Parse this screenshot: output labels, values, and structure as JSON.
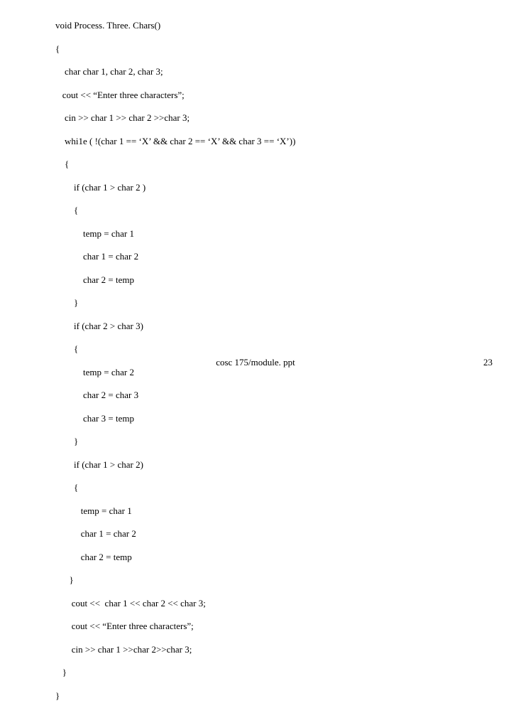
{
  "code": {
    "l01": "void Process. Three. Chars()",
    "l02": "{",
    "l03": "    char char 1, char 2, char 3;",
    "l04": "   cout << “Enter three characters”;",
    "l05": "    cin >> char 1 >> char 2 >>char 3;",
    "l06": "    whi1e ( !(char 1 == ‘X’ && char 2 == ‘X’ && char 3 == ‘X’))",
    "l07": "    {",
    "l08": "        if (char 1 > char 2 )",
    "l09": "        {",
    "l10": "            temp = char 1",
    "l11": "            char 1 = char 2",
    "l12": "            char 2 = temp",
    "l13": "        }",
    "l14": "        if (char 2 > char 3)",
    "l15": "        {",
    "l16": "            temp = char 2",
    "l17": "            char 2 = char 3",
    "l18": "            char 3 = temp",
    "l19": "        }",
    "l20": "        if (char 1 > char 2)",
    "l21": "        {",
    "l22": "           temp = char 1",
    "l23": "           char 1 = char 2",
    "l24": "           char 2 = temp",
    "l25": "      }",
    "l26": "       cout <<  char 1 << char 2 << char 3;",
    "l27": "       cout << “Enter three characters”;",
    "l28": "       cin >> char 1 >>char 2>>char 3;",
    "l29": "   }",
    "l30": "}"
  },
  "footer": {
    "center": "cosc 175/module. ppt",
    "page": "23"
  }
}
